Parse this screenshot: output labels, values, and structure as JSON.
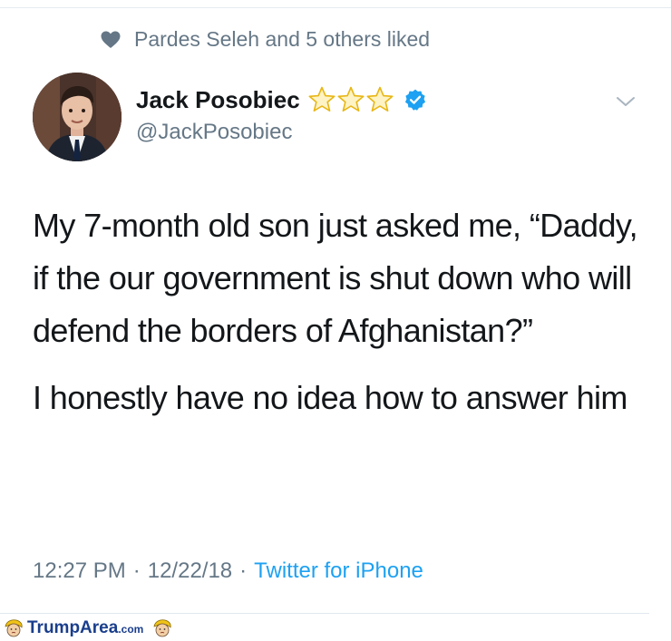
{
  "social_context": {
    "text": "Pardes Seleh and 5 others liked",
    "icon": "heart-icon"
  },
  "author": {
    "name": "Jack Posobiec",
    "handle": "@JackPosobiec",
    "badges": [
      "star-icon",
      "star-icon",
      "star-icon",
      "verified-icon"
    ]
  },
  "tweet": {
    "paragraph_1": "My 7-month old son just asked me, “Daddy, if the our government is shut down who will defend the borders of Afghanistan?”",
    "paragraph_2": "I honestly have no idea how to answer him"
  },
  "meta": {
    "time": "12:27 PM",
    "separator_1": "·",
    "date": "12/22/18",
    "separator_2": "·",
    "source": "Twitter for iPhone"
  },
  "watermark": {
    "brand": "TrumpArea",
    "suffix": ".com"
  },
  "colors": {
    "accent": "#1da1f2",
    "muted": "#657786",
    "text": "#14171a",
    "star": "#f5c518",
    "watermark": "#1a3e8c"
  }
}
